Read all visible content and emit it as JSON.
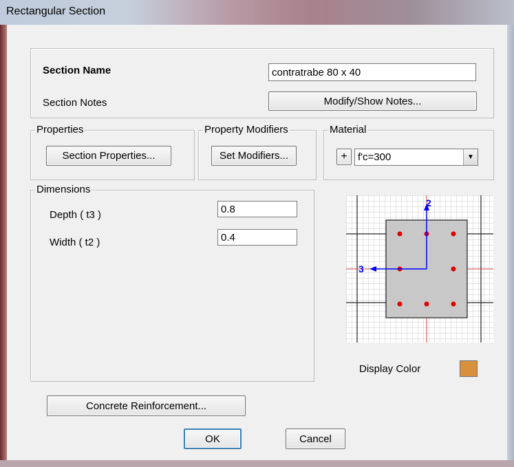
{
  "window": {
    "title": "Rectangular Section"
  },
  "section": {
    "name_label": "Section Name",
    "name_value": "contratrabe 80 x 40",
    "notes_label": "Section Notes",
    "notes_button": "Modify/Show Notes..."
  },
  "properties": {
    "legend": "Properties",
    "button": "Section Properties..."
  },
  "modifiers": {
    "legend": "Property Modifiers",
    "button": "Set Modifiers..."
  },
  "material": {
    "legend": "Material",
    "plus": "+",
    "selected": "f'c=300"
  },
  "dimensions": {
    "legend": "Dimensions",
    "depth_label": "Depth  ( t3 )",
    "depth_value": "0.8",
    "width_label": "Width  ( t2 )",
    "width_value": "0.4"
  },
  "preview": {
    "axis_2": "2",
    "axis_3": "3",
    "display_color_label": "Display Color",
    "display_color": "#d9903d",
    "bar_color": "#e00000",
    "axis_color": "#0000ff"
  },
  "buttons": {
    "reinforcement": "Concrete Reinforcement...",
    "ok": "OK",
    "cancel": "Cancel"
  }
}
